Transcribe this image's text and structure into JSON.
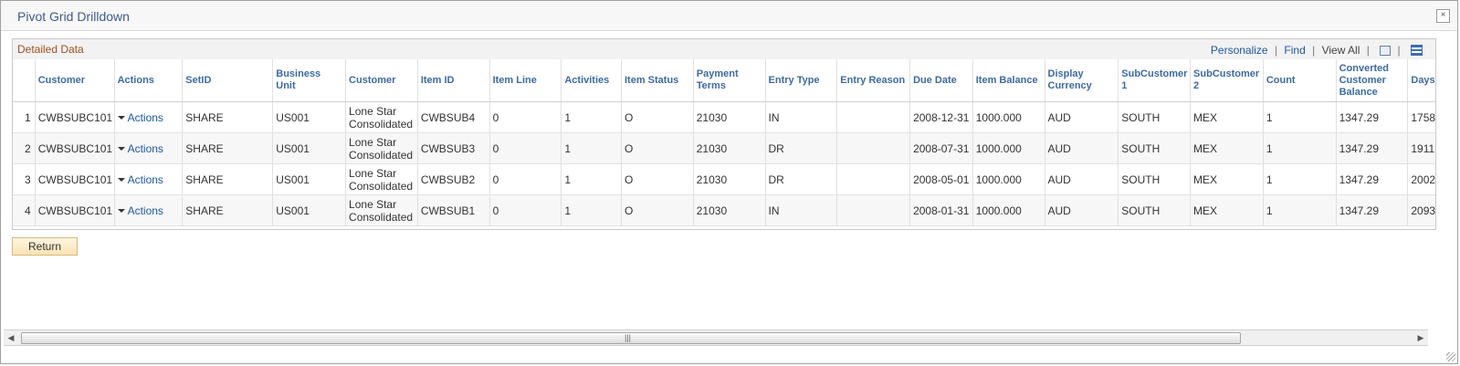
{
  "window": {
    "title": "Pivot Grid Drilldown",
    "close_glyph": "×"
  },
  "grid": {
    "title": "Detailed Data",
    "links": {
      "personalize": "Personalize",
      "find": "Find",
      "view_all": "View All"
    },
    "columns": [
      "",
      "Customer",
      "Actions",
      "SetID",
      "Business Unit",
      "Customer",
      "Item ID",
      "Item Line",
      "Activities",
      "Item Status",
      "Payment Terms",
      "Entry Type",
      "Entry Reason",
      "Due Date",
      "Item Balance",
      "Display Currency",
      "SubCustomer 1",
      "SubCustomer 2",
      "Count",
      "Converted Customer Balance",
      "Days"
    ],
    "rows": [
      [
        "1",
        "CWBSUBC101",
        "Actions",
        "SHARE",
        "US001",
        "Lone Star Consolidated",
        "CWBSUB4",
        "0",
        "1",
        "O",
        "21030",
        "IN",
        "",
        "2008-12-31",
        "1000.000",
        "AUD",
        "SOUTH",
        "MEX",
        "1",
        "1347.29",
        "1758"
      ],
      [
        "2",
        "CWBSUBC101",
        "Actions",
        "SHARE",
        "US001",
        "Lone Star Consolidated",
        "CWBSUB3",
        "0",
        "1",
        "O",
        "21030",
        "DR",
        "",
        "2008-07-31",
        "1000.000",
        "AUD",
        "SOUTH",
        "MEX",
        "1",
        "1347.29",
        "1911"
      ],
      [
        "3",
        "CWBSUBC101",
        "Actions",
        "SHARE",
        "US001",
        "Lone Star Consolidated",
        "CWBSUB2",
        "0",
        "1",
        "O",
        "21030",
        "DR",
        "",
        "2008-05-01",
        "1000.000",
        "AUD",
        "SOUTH",
        "MEX",
        "1",
        "1347.29",
        "2002"
      ],
      [
        "4",
        "CWBSUBC101",
        "Actions",
        "SHARE",
        "US001",
        "Lone Star Consolidated",
        "CWBSUB1",
        "0",
        "1",
        "O",
        "21030",
        "IN",
        "",
        "2008-01-31",
        "1000.000",
        "AUD",
        "SOUTH",
        "MEX",
        "1",
        "1347.29",
        "2093"
      ]
    ]
  },
  "buttons": {
    "return": "Return"
  },
  "scrollbar": {
    "left_arrow": "◀",
    "right_arrow": "▶",
    "grip": "|||"
  },
  "colors": {
    "link": "#1c57a6",
    "header_text": "#3c6aa6",
    "grid_title": "#a0501e",
    "window_title": "#3d5c8c"
  }
}
